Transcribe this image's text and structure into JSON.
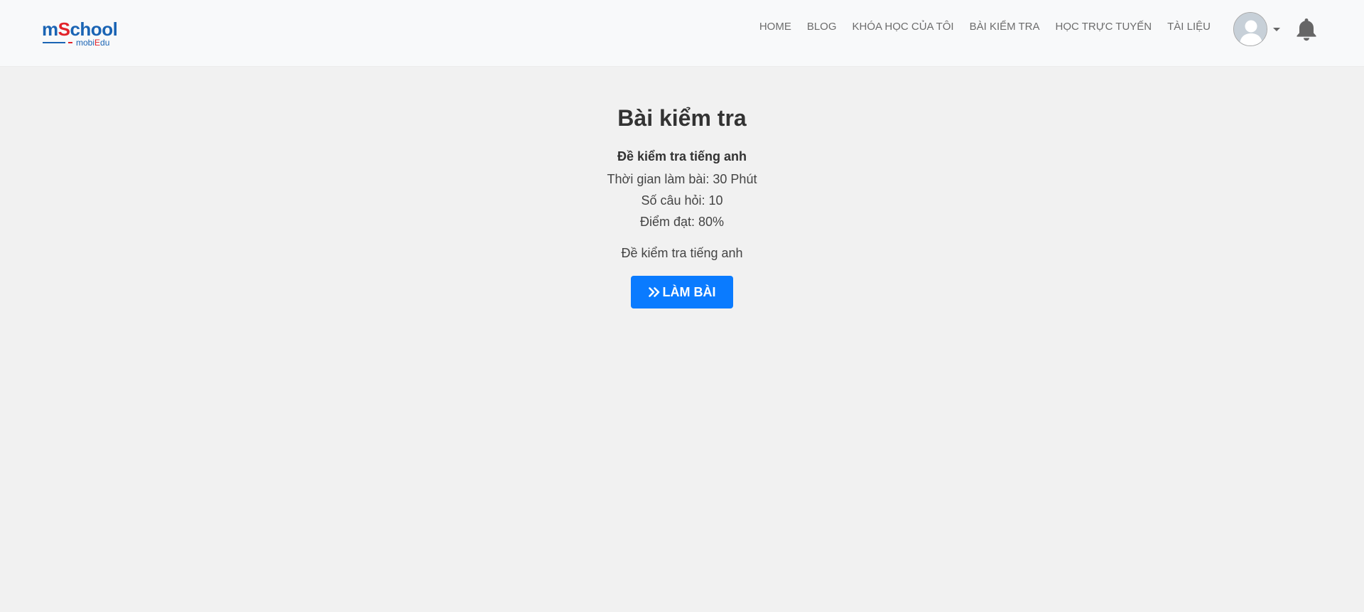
{
  "logo": {
    "main_prefix": "m",
    "main_highlight": "S",
    "main_suffix": "chool",
    "sub_prefix": "mobi",
    "sub_highlight": "E",
    "sub_suffix": "du"
  },
  "nav": {
    "items": [
      {
        "label": "HOME"
      },
      {
        "label": "BLOG"
      },
      {
        "label": "KHÓA HỌC CỦA TÔI"
      },
      {
        "label": "BÀI KIỂM TRA"
      },
      {
        "label": "HỌC TRỰC TUYẾN"
      },
      {
        "label": "TÀI LIỆU"
      }
    ],
    "avatar_icon": "user-avatar-icon",
    "dropdown_icon": "caret-down-icon",
    "notification_icon": "bell-icon"
  },
  "page": {
    "title": "Bài kiểm tra",
    "exam_name": "Đề kiểm tra tiếng anh",
    "time_line": "Thời gian làm bài: 30 Phút",
    "question_count_line": "Số câu hỏi: 10",
    "pass_score_line": "Điểm đạt: 80%",
    "description": "Đề kiểm tra tiếng anh",
    "start_button_label": "LÀM BÀI",
    "start_button_icon": "double-chevron-right-icon"
  },
  "colors": {
    "accent": "#0a7bff",
    "logo_blue": "#1a64b4",
    "logo_red": "#e2232a"
  }
}
